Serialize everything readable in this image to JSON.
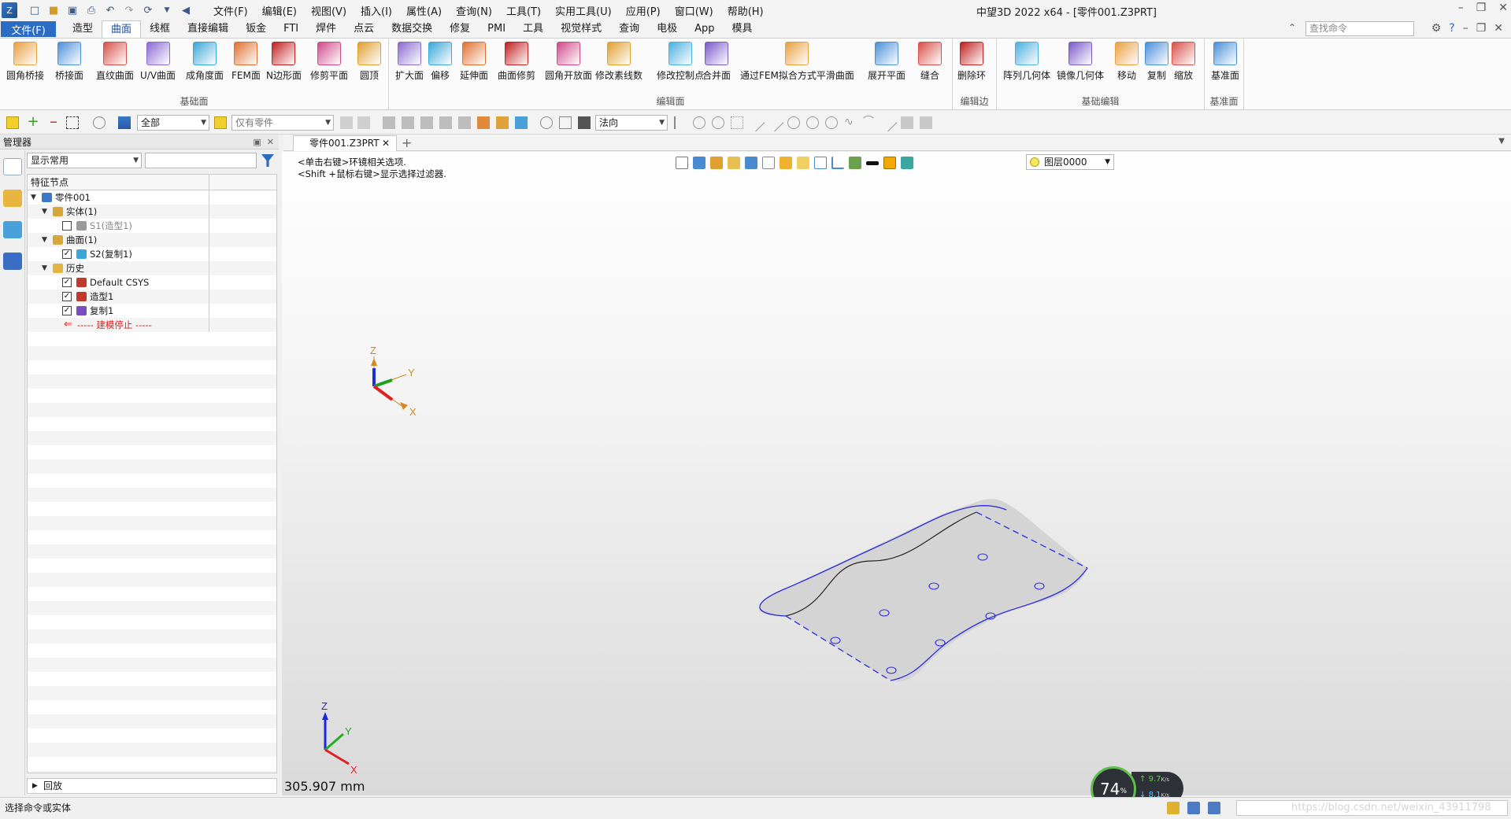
{
  "app": {
    "title": "中望3D 2022 x64 - [零件001.Z3PRT]",
    "menus": [
      "文件(F)",
      "编辑(E)",
      "视图(V)",
      "插入(I)",
      "属性(A)",
      "查询(N)",
      "工具(T)",
      "实用工具(U)",
      "应用(P)",
      "窗口(W)",
      "帮助(H)"
    ]
  },
  "ribbon_tabs": {
    "file": "文件(F)",
    "tabs": [
      "造型",
      "曲面",
      "线框",
      "直接编辑",
      "钣金",
      "FTI",
      "焊件",
      "点云",
      "数据交换",
      "修复",
      "PMI",
      "工具",
      "视觉样式",
      "查询",
      "电极",
      "App",
      "模具"
    ],
    "active": "曲面",
    "search_placeholder": "查找命令"
  },
  "ribbon": {
    "groups": [
      {
        "label": "基础面",
        "buttons": [
          "圆角桥接",
          "桥接面",
          "直纹曲面",
          "U/V曲面",
          "成角度面",
          "FEM面",
          "N边形面",
          "修剪平面",
          "圆顶"
        ]
      },
      {
        "label": "编辑面",
        "buttons": [
          "扩大面",
          "偏移",
          "延伸面",
          "曲面修剪",
          "圆角开放面",
          "修改素线数",
          "修改控制点",
          "合并面",
          "通过FEM拟合方式平滑曲面",
          "展开平面",
          "缝合"
        ]
      },
      {
        "label": "编辑边",
        "buttons": [
          "删除环"
        ]
      },
      {
        "label": "基础编辑",
        "buttons": [
          "阵列几何体",
          "镜像几何体",
          "移动",
          "复制",
          "缩放"
        ]
      },
      {
        "label": "基准面",
        "buttons": [
          "基准面"
        ]
      }
    ]
  },
  "toolbar2": {
    "filter_value": "全部",
    "scope_value": "仅有零件",
    "direction_value": "法向"
  },
  "manager": {
    "title": "管理器",
    "display_combo": "显示常用",
    "column_header": "特征节点",
    "tree": [
      {
        "label": "零件001",
        "level": 0,
        "expand": true,
        "check": false,
        "icon": "part-icon",
        "color": "#3b78c8"
      },
      {
        "label": "实体(1)",
        "level": 1,
        "expand": true,
        "check": false,
        "icon": "solid-folder-icon",
        "color": "#d8a53a"
      },
      {
        "label": "S1(造型1)",
        "level": 2,
        "expand": false,
        "check": "unchecked",
        "icon": "solid-icon",
        "color": "#9a9a9a",
        "dim": true
      },
      {
        "label": "曲面(1)",
        "level": 1,
        "expand": true,
        "check": false,
        "icon": "surface-folder-icon",
        "color": "#d8a53a"
      },
      {
        "label": "S2(复制1)",
        "level": 2,
        "expand": false,
        "check": "checked",
        "icon": "surface-icon",
        "color": "#3aa7d6"
      },
      {
        "label": "历史",
        "level": 1,
        "expand": true,
        "check": false,
        "icon": "history-folder-icon",
        "color": "#e2b440"
      },
      {
        "label": "Default CSYS",
        "level": 2,
        "expand": false,
        "check": "checked",
        "icon": "csys-icon",
        "color": "#c0392b"
      },
      {
        "label": "造型1",
        "level": 2,
        "expand": false,
        "check": "checked",
        "icon": "shape-icon",
        "color": "#c0392b"
      },
      {
        "label": "复制1",
        "level": 2,
        "expand": false,
        "check": "checked",
        "icon": "copy-icon",
        "color": "#7a4ec0"
      },
      {
        "label": "----- 建模停止 -----",
        "level": 2,
        "expand": false,
        "check": false,
        "icon": "stop-arrow-icon",
        "color": "#e02020",
        "stop": true
      }
    ],
    "playback": "回放"
  },
  "document": {
    "tab": "零件001.Z3PRT",
    "hint_line1": "<单击右键>环镜相关选项.",
    "hint_line2": "<Shift +鼠标右键>显示选择过滤器.",
    "layer": "图层0000",
    "scale": "305.907 mm",
    "axis_labels": {
      "x": "X",
      "y": "Y",
      "z": "Z"
    }
  },
  "status": {
    "prompt": "选择命令或实体",
    "watermark": "https://blog.csdn.net/weixin_43911798"
  },
  "net_widget": {
    "percent": "74",
    "percent_unit": "%",
    "up": "9.7",
    "down": "8.1",
    "unit": "K/s"
  }
}
